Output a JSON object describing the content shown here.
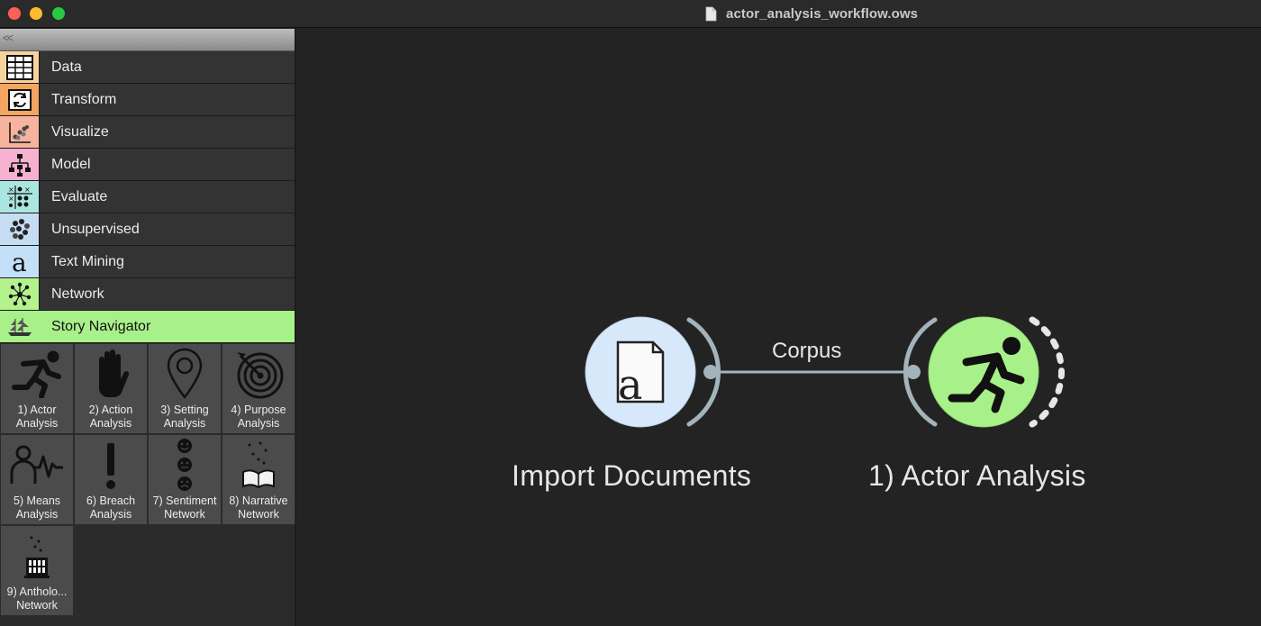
{
  "window": {
    "title": "actor_analysis_workflow.ows"
  },
  "sidebar": {
    "collapse_glyph": "<<",
    "categories": [
      {
        "label": "Data",
        "color": "#f7d39b",
        "icon": "table-icon"
      },
      {
        "label": "Transform",
        "color": "#f5a461",
        "icon": "transform-icon"
      },
      {
        "label": "Visualize",
        "color": "#f7b39d",
        "icon": "scatter-icon"
      },
      {
        "label": "Model",
        "color": "#f8b0d0",
        "icon": "tree-icon"
      },
      {
        "label": "Evaluate",
        "color": "#a9e6e0",
        "icon": "evaluate-icon"
      },
      {
        "label": "Unsupervised",
        "color": "#c6dcf3",
        "icon": "cluster-icon"
      },
      {
        "label": "Text Mining",
        "color": "#c4dff8",
        "icon": "text-a-icon"
      },
      {
        "label": "Network",
        "color": "#b4f28d",
        "icon": "network-icon"
      },
      {
        "label": "Story Navigator",
        "color": "#a8f089",
        "icon": "ship-icon"
      }
    ],
    "widgets": [
      {
        "label": "1) Actor\nAnalysis",
        "icon": "running-man-icon"
      },
      {
        "label": "2) Action\nAnalysis",
        "icon": "hand-icon"
      },
      {
        "label": "3) Setting\nAnalysis",
        "icon": "location-pin-icon"
      },
      {
        "label": "4) Purpose\nAnalysis",
        "icon": "target-icon"
      },
      {
        "label": "5) Means\nAnalysis",
        "icon": "person-pulse-icon"
      },
      {
        "label": "6) Breach\nAnalysis",
        "icon": "exclamation-icon"
      },
      {
        "label": "7) Sentiment\nNetwork",
        "icon": "faces-icon"
      },
      {
        "label": "8) Narrative\nNetwork",
        "icon": "book-icon"
      },
      {
        "label": "9) Antholo...\nNetwork",
        "icon": "anthology-icon"
      }
    ]
  },
  "canvas": {
    "nodes": [
      {
        "label": "Import Documents",
        "icon": "document-a-icon",
        "color": "#d7e8fb"
      },
      {
        "label": "1) Actor Analysis",
        "icon": "running-man-icon",
        "color": "#a8f089"
      }
    ],
    "link": {
      "label": "Corpus"
    }
  }
}
